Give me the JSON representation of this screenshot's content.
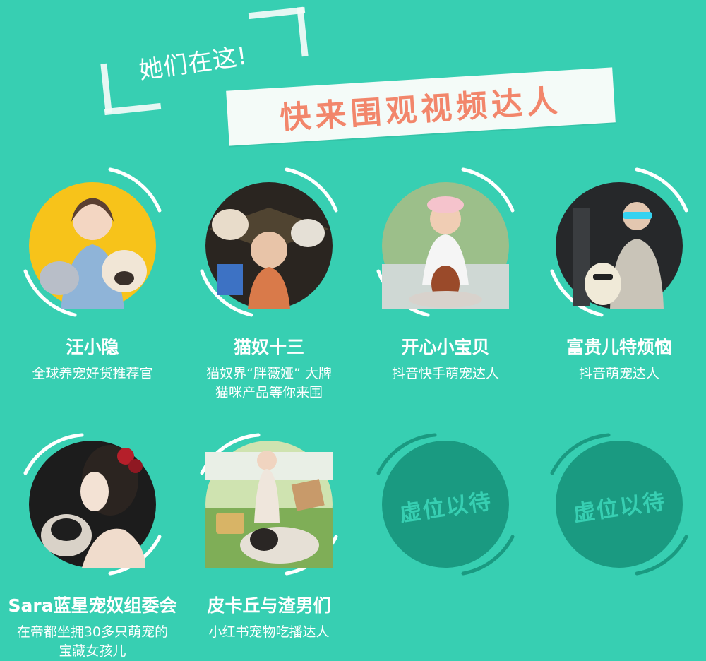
{
  "header": {
    "intro": "她们在这!",
    "title": "快来围观视频达人"
  },
  "colors": {
    "background": "#37cfb2",
    "title_text": "#f2866b",
    "placeholder_circle": "#1a9a81",
    "ring": "#ffffff"
  },
  "influencers": [
    {
      "name": "汪小隐",
      "desc_lines": [
        "全球养宠好货推荐官"
      ]
    },
    {
      "name": "猫奴十三",
      "desc_lines": [
        "猫奴界“胖薇娅” 大牌",
        "猫咪产品等你来围"
      ]
    },
    {
      "name": "开心小宝贝",
      "desc_lines": [
        "抖音快手萌宠达人"
      ]
    },
    {
      "name": "富贵儿特烦恼",
      "desc_lines": [
        "抖音萌宠达人"
      ]
    },
    {
      "name": "Sara蓝星宠奴组委会",
      "desc_lines": [
        "在帝都坐拥30多只萌宠的",
        "宝藏女孩儿"
      ]
    },
    {
      "name": "皮卡丘与渣男们",
      "desc_lines": [
        "小红书宠物吃播达人"
      ]
    }
  ],
  "placeholders": [
    {
      "label": "虚位以待"
    },
    {
      "label": "虚位以待"
    }
  ]
}
